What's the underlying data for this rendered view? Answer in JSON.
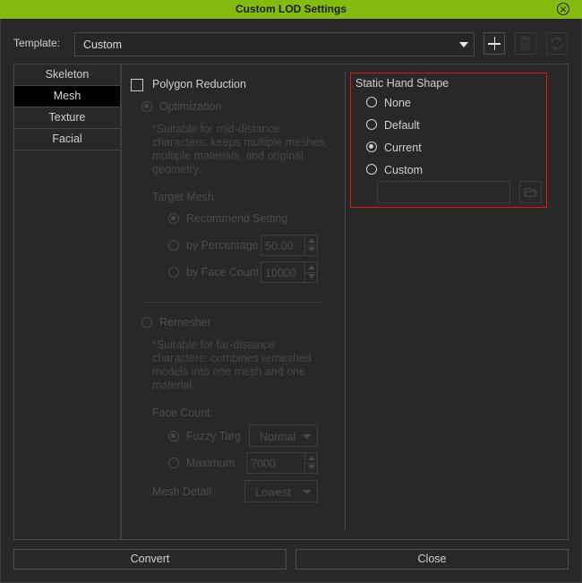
{
  "window": {
    "title": "Custom LOD Settings",
    "close_icon": "close-circle-icon"
  },
  "template": {
    "label": "Template:",
    "value": "Custom",
    "add_icon": "plus-icon",
    "delete_icon": "trash-icon",
    "refresh_icon": "refresh-icon"
  },
  "tabs": [
    {
      "label": "Skeleton",
      "active": false
    },
    {
      "label": "Mesh",
      "active": true
    },
    {
      "label": "Texture",
      "active": false
    },
    {
      "label": "Facial",
      "active": false
    }
  ],
  "mesh": {
    "polygon_reduction": {
      "label": "Polygon Reduction",
      "checked": false
    },
    "optimization": {
      "label": "Optimization",
      "selected": true,
      "description": "*Suitable for mid-distance characters: keeps multiple meshes, multiple materials, and original geometry.",
      "target_mesh_label": "Target Mesh",
      "options": [
        {
          "label": "Recommend Setting",
          "selected": true
        },
        {
          "label": "by Percentage",
          "selected": false,
          "value": "50.00"
        },
        {
          "label": "by Face Count",
          "selected": false,
          "value": "10000"
        }
      ]
    },
    "remesher": {
      "label": "Remesher",
      "selected": false,
      "description": "*Suitable for far-distance characters: combines remeshed models into one mesh and one material.",
      "face_count_label": "Face Count",
      "fuzzy_target": {
        "label": "Fuzzy Targe",
        "selected": true,
        "value": "Normal"
      },
      "maximum": {
        "label": "Maximum",
        "selected": false,
        "value": "7000"
      },
      "mesh_detail": {
        "label": "Mesh Detail",
        "value": "Lowest"
      }
    }
  },
  "static_hand_shape": {
    "title": "Static Hand Shape",
    "options": [
      {
        "label": "None",
        "selected": false
      },
      {
        "label": "Default",
        "selected": false
      },
      {
        "label": "Current",
        "selected": true
      },
      {
        "label": "Custom",
        "selected": false
      }
    ],
    "custom_path": "",
    "browse_icon": "folder-icon",
    "highlight_color": "#e0141b"
  },
  "footer": {
    "convert_label": "Convert",
    "close_label": "Close"
  },
  "colors": {
    "titlebar": "#83bb0e",
    "background": "#282828"
  }
}
